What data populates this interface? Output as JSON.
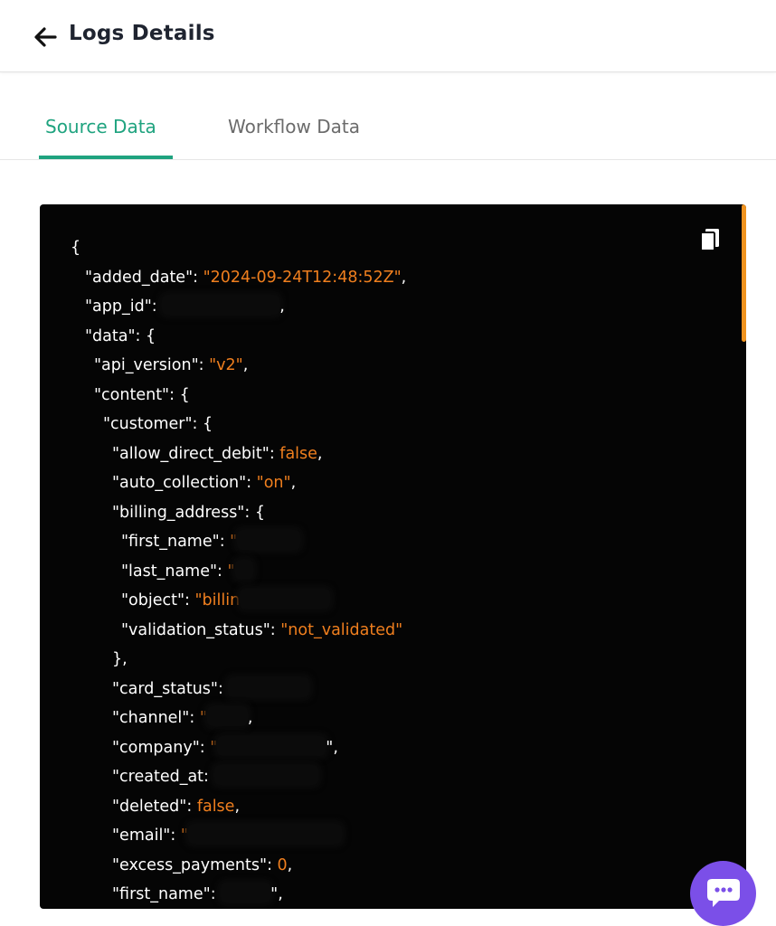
{
  "header": {
    "title": "Logs Details",
    "back_icon": "arrow-left-icon"
  },
  "tabs": [
    {
      "label": "Source Data",
      "active": true
    },
    {
      "label": "Workflow Data",
      "active": false
    }
  ],
  "colors": {
    "accent": "#1fa37f",
    "string": "#f07f1e",
    "panel": "#050505",
    "chat": "#7b4fe8",
    "scroll": "#f0931f"
  },
  "code": {
    "lines": [
      {
        "indent": 0,
        "text": "{"
      },
      {
        "indent": 1,
        "key": "\"added_date\"",
        "value": "\"2024-09-24T12:48:52Z\"",
        "tail": ","
      },
      {
        "indent": 1,
        "key": "\"app_id\"",
        "redacted": true,
        "tail": ","
      },
      {
        "indent": 1,
        "key": "\"data\"",
        "open": "{"
      },
      {
        "indent": 2,
        "key": "\"api_version\"",
        "value": "\"v2\"",
        "tail": ","
      },
      {
        "indent": 2,
        "key": "\"content\"",
        "open": "{"
      },
      {
        "indent": 3,
        "key": "\"customer\"",
        "open": "{"
      },
      {
        "indent": 4,
        "key": "\"allow_direct_debit\"",
        "value": "false",
        "tail": ","
      },
      {
        "indent": 4,
        "key": "\"auto_collection\"",
        "value": "\"on\"",
        "tail": ","
      },
      {
        "indent": 4,
        "key": "\"billing_address\"",
        "open": "{"
      },
      {
        "indent": 5,
        "key": "\"first_name\"",
        "value": "\"",
        "redacted": true
      },
      {
        "indent": 5,
        "key": "\"last_name\"",
        "value": "\"",
        "redacted": true
      },
      {
        "indent": 5,
        "key": "\"object\"",
        "value": "\"billin",
        "redacted": true
      },
      {
        "indent": 5,
        "key": "\"validation_status\"",
        "value": "\"not_validated\""
      },
      {
        "indent": 4,
        "text": "},"
      },
      {
        "indent": 4,
        "key": "\"card_status\"",
        "redacted": true
      },
      {
        "indent": 4,
        "key": "\"channel\"",
        "value": "\"",
        "redacted": true,
        "tail": ","
      },
      {
        "indent": 4,
        "key": "\"company\"",
        "value": "\"",
        "redacted": true,
        "tail": "\","
      },
      {
        "indent": 4,
        "key": "\"created_at",
        "redacted": true
      },
      {
        "indent": 4,
        "key": "\"deleted\"",
        "value": "false",
        "tail": ","
      },
      {
        "indent": 4,
        "key": "\"email\"",
        "value": "\"",
        "redacted": true
      },
      {
        "indent": 4,
        "key": "\"excess_payments\"",
        "value": "0",
        "tail": ","
      },
      {
        "indent": 4,
        "key": "\"first_name\"",
        "redacted": true,
        "tail": "\","
      }
    ]
  }
}
